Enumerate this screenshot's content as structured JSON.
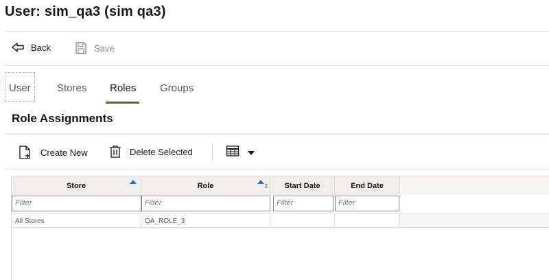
{
  "page": {
    "title": "User: sim_qa3 (sim qa3)"
  },
  "toolbar": {
    "back_label": "Back",
    "save_label": "Save"
  },
  "tabs": [
    {
      "label": "User",
      "active": false
    },
    {
      "label": "Stores",
      "active": false
    },
    {
      "label": "Roles",
      "active": true
    },
    {
      "label": "Groups",
      "active": false
    }
  ],
  "section": {
    "title": "Role Assignments"
  },
  "actions": {
    "create_label": "Create New",
    "delete_label": "Delete Selected"
  },
  "table": {
    "columns": [
      {
        "label": "Store",
        "sort": "ascending",
        "sort_order": ""
      },
      {
        "label": "Role",
        "sort": "ascending",
        "sort_order": "2"
      },
      {
        "label": "Start Date"
      },
      {
        "label": "End Date"
      }
    ],
    "filter_placeholder": "Filter",
    "rows": [
      {
        "store": "All Stores",
        "role": "QA_ROLE_3",
        "start_date": "",
        "end_date": ""
      }
    ]
  },
  "colors": {
    "accent": "#4e6a43",
    "sort_icon": "#2c6fb6"
  }
}
